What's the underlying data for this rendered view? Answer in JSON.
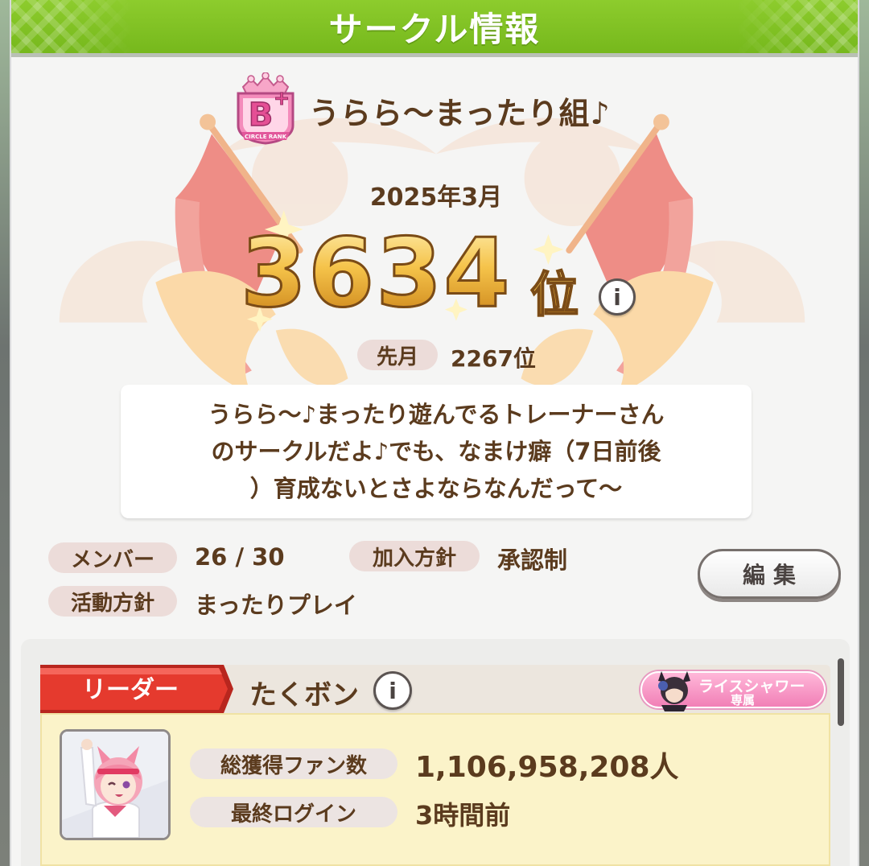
{
  "header": {
    "title": "サークル情報"
  },
  "circle": {
    "rank_badge": {
      "letter": "B",
      "modifier": "+",
      "caption": "CIRCLE RANK"
    },
    "name": "うらら〜まったり組♪",
    "month": "2025年3月",
    "rank_number": "3634",
    "rank_unit": "位",
    "prev_label": "先月",
    "prev_value": "2267位",
    "description_lines": [
      "うらら〜♪まったり遊んでるトレーナーさん",
      "のサークルだよ♪でも、なまけ癖（7日前後",
      "）育成ないとさよならなんだって〜"
    ],
    "info_icon": "i"
  },
  "details": {
    "member_label": "メンバー",
    "member_value": "26 / 30",
    "join_label": "加入方針",
    "join_value": "承認制",
    "activity_label": "活動方針",
    "activity_value": "まったりプレイ",
    "edit_button": "編集"
  },
  "leader": {
    "tag": "リーダー",
    "name": "たくボン",
    "info_icon": "i",
    "affiliation_line1": "ライスシャワー",
    "affiliation_line2": "専属",
    "fans_label": "総獲得ファン数",
    "fans_value": "1,106,958,208人",
    "login_label": "最終ログイン",
    "login_value": "3時間前"
  },
  "colors": {
    "header_green": "#7dbf22",
    "text_brown": "#5b3b1e",
    "pill_bg": "#ecdcd9",
    "leader_red": "#e53a2e",
    "affiliation_pink": "#f38fbf"
  }
}
